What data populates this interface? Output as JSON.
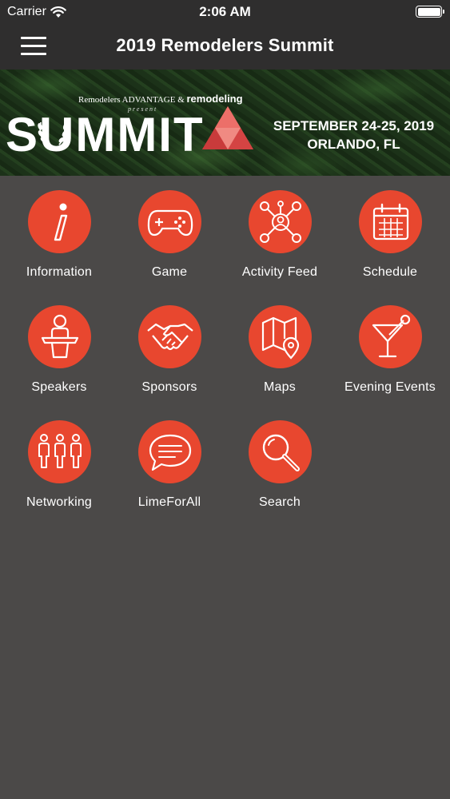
{
  "status_bar": {
    "carrier": "Carrier",
    "time": "2:06 AM",
    "wifi_icon": "wifi-icon",
    "battery_icon": "battery-icon"
  },
  "nav_bar": {
    "title": "2019 Remodelers Summit",
    "menu_icon": "hamburger-menu-icon"
  },
  "banner": {
    "presenters_left": "Remodelers ADVANTAGE",
    "presenters_amp": "&",
    "presenters_right": "remodeling",
    "present": "present",
    "event_word": "SUMMIT",
    "dates": "SEPTEMBER 24-25, 2019",
    "location": "ORLANDO, FL"
  },
  "colors": {
    "accent": "#e8472f",
    "background": "#4b4948",
    "bar": "#2f2e2e"
  },
  "tiles": [
    {
      "label": "Information",
      "icon": "information-icon"
    },
    {
      "label": "Game",
      "icon": "gamepad-icon"
    },
    {
      "label": "Activity Feed",
      "icon": "activity-feed-icon"
    },
    {
      "label": "Schedule",
      "icon": "calendar-icon"
    },
    {
      "label": "Speakers",
      "icon": "speaker-podium-icon"
    },
    {
      "label": "Sponsors",
      "icon": "handshake-icon"
    },
    {
      "label": "Maps",
      "icon": "map-icon"
    },
    {
      "label": "Evening Events",
      "icon": "cocktail-icon"
    },
    {
      "label": "Networking",
      "icon": "people-icon"
    },
    {
      "label": "LimeForAll",
      "icon": "chat-bubble-icon"
    },
    {
      "label": "Search",
      "icon": "search-icon"
    }
  ]
}
